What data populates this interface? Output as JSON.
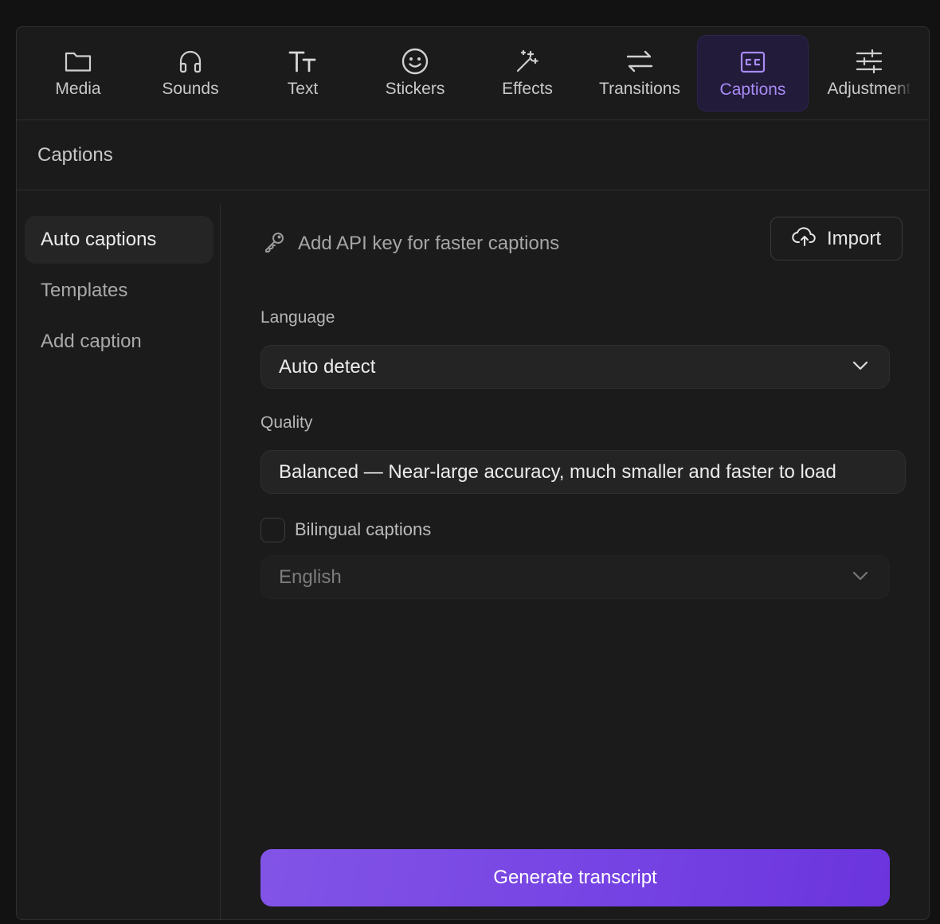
{
  "tabs": [
    {
      "label": "Media",
      "icon": "folder-icon"
    },
    {
      "label": "Sounds",
      "icon": "headphones-icon"
    },
    {
      "label": "Text",
      "icon": "text-icon"
    },
    {
      "label": "Stickers",
      "icon": "smiley-icon"
    },
    {
      "label": "Effects",
      "icon": "magic-wand-icon"
    },
    {
      "label": "Transitions",
      "icon": "arrows-swap-icon"
    },
    {
      "label": "Captions",
      "icon": "closed-captions-icon",
      "active": true
    },
    {
      "label": "Adjustment",
      "icon": "sliders-icon"
    }
  ],
  "section": {
    "title": "Captions"
  },
  "subnav": {
    "items": [
      {
        "label": "Auto captions",
        "active": true
      },
      {
        "label": "Templates"
      },
      {
        "label": "Add caption"
      }
    ]
  },
  "main": {
    "api_key_link": "Add API key for faster captions",
    "import_label": "Import",
    "language": {
      "label": "Language",
      "value": "Auto detect"
    },
    "quality": {
      "label": "Quality",
      "value": "Balanced — Near-large accuracy, much smaller and faster to load"
    },
    "bilingual": {
      "label": "Bilingual captions",
      "checked": false
    },
    "second_language": {
      "value": "English",
      "disabled": true
    },
    "generate_label": "Generate transcript"
  },
  "colors": {
    "accent": "#a98bf5",
    "button_gradient_start": "#8254e6",
    "button_gradient_end": "#6b34dd",
    "panel_bg": "#1b1b1b",
    "page_bg": "#121212"
  }
}
